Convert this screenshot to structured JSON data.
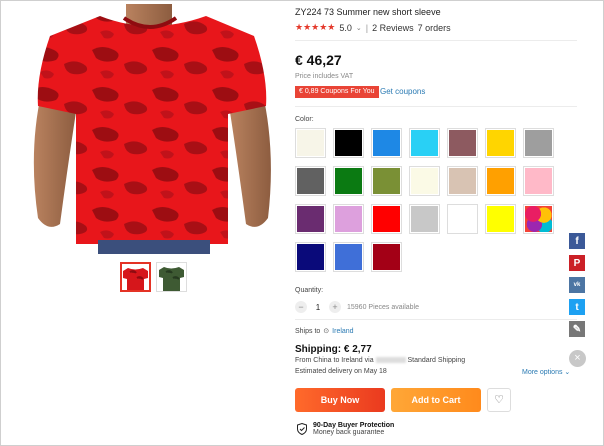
{
  "product": {
    "title": "ZY224 73 Summer new short sleeve",
    "rating_value": "5.0",
    "reviews": "2 Reviews",
    "orders": "7 orders",
    "price": "€ 46,27",
    "vat_note": "Price includes VAT",
    "coupon_label": "€ 0,89 Coupons For You",
    "get_coupons": "Get coupons"
  },
  "colors": {
    "label": "Color:",
    "swatches": [
      "#f7f5e8",
      "#000000",
      "#1e88e5",
      "#29d0f5",
      "#8d5a60",
      "#ffd500",
      "#9e9e9e",
      "#616161",
      "#0b7a12",
      "#7a9035",
      "#fbfae6",
      "#d8c3b3",
      "#ffa000",
      "#ffb9c8",
      "#6a2c70",
      "#dda0dd",
      "#ff0000",
      "#c8c8c8",
      "#ffffff",
      "#ffff00",
      "multi",
      "#0a0a7a",
      "#3f6fd8",
      "#a30016"
    ]
  },
  "quantity": {
    "label": "Quantity:",
    "minus": "−",
    "plus": "+",
    "value": "1",
    "available": "15960 Pieces available"
  },
  "shipping": {
    "ships_to_label": "Ships to",
    "ships_to_country": "Ireland",
    "cost": "Shipping: € 2,77",
    "from_prefix": "From China to Ireland via",
    "method": "Standard Shipping",
    "estimated": "Estimated delivery on May 18",
    "more_options": "More options"
  },
  "actions": {
    "buy_now": "Buy Now",
    "add_to_cart": "Add to Cart"
  },
  "protection": {
    "title": "90-Day Buyer Protection",
    "subtitle": "Money back guarantee"
  },
  "share": {
    "facebook": "f",
    "pinterest": "P",
    "vk": "vk",
    "twitter": "t",
    "close": "×"
  },
  "accent_colors": {
    "buy_now": "#ea3a1f",
    "add_to_cart": "#ff8a1c",
    "coupon": "#e94436",
    "link": "#2a7ab3"
  }
}
